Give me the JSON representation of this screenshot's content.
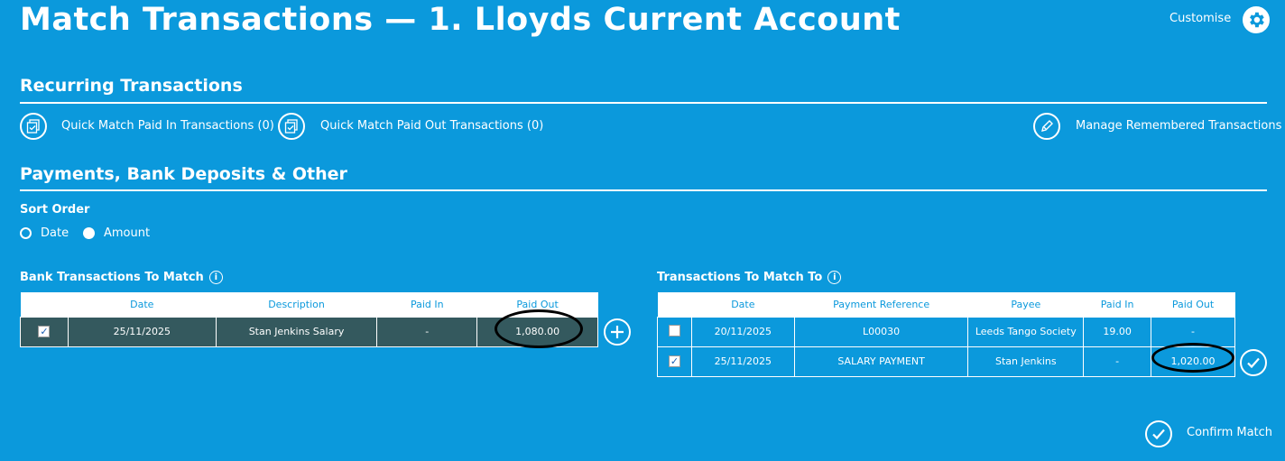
{
  "header": {
    "title": "Match Transactions — 1. Lloyds Current Account",
    "customise_label": "Customise",
    "customise_icon": "gear-icon"
  },
  "recurring": {
    "title": "Recurring Transactions",
    "quick_paid_in": "Quick Match Paid In Transactions (0)",
    "quick_paid_out": "Quick Match Paid Out Transactions (0)",
    "manage": "Manage Remembered Transactions"
  },
  "payments": {
    "title": "Payments, Bank Deposits & Other",
    "sort_order_label": "Sort Order",
    "sort_options": [
      "Date",
      "Amount"
    ],
    "sort_selected": "Date"
  },
  "bank_transactions": {
    "label": "Bank Transactions To Match",
    "columns": [
      "",
      "Date",
      "Description",
      "Paid In",
      "Paid Out"
    ],
    "rows": [
      {
        "checked": true,
        "date": "25/11/2025",
        "description": "Stan Jenkins Salary",
        "paid_in": "-",
        "paid_out": "1,080.00"
      }
    ]
  },
  "match_to": {
    "label": "Transactions To Match To",
    "columns": [
      "",
      "Date",
      "Payment Reference",
      "Payee",
      "Paid In",
      "Paid Out"
    ],
    "rows": [
      {
        "checked": false,
        "date": "20/11/2025",
        "reference": "L00030",
        "payee": "Leeds Tango Society",
        "paid_in": "19.00",
        "paid_out": "-"
      },
      {
        "checked": true,
        "date": "25/11/2025",
        "reference": "SALARY PAYMENT",
        "payee": "Stan Jenkins",
        "paid_in": "-",
        "paid_out": "1,020.00"
      }
    ]
  },
  "footer": {
    "confirm_label": "Confirm Match"
  },
  "info_glyph": "i",
  "check_glyph": "✓",
  "colors": {
    "background": "#0b99dc",
    "selected_row": "#34595e",
    "text": "#ffffff",
    "annotation": "#000000"
  }
}
